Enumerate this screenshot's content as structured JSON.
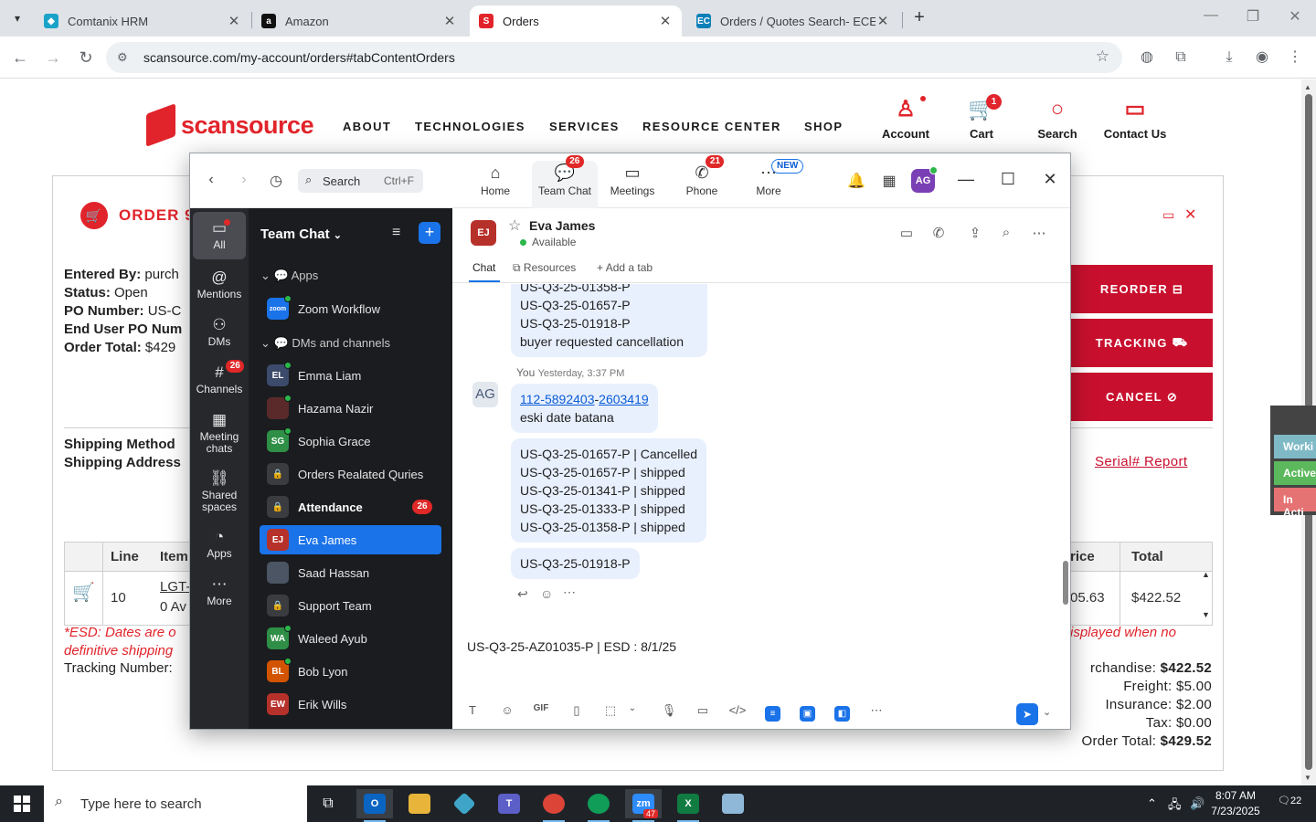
{
  "browser": {
    "tabs": [
      {
        "title": "Comtanix HRM",
        "active": false
      },
      {
        "title": "Amazon",
        "active": false
      },
      {
        "title": "Orders",
        "active": true
      },
      {
        "title": "Orders / Quotes Search- ECExp",
        "active": false
      }
    ],
    "url": "scansource.com/my-account/orders#tabContentOrders"
  },
  "site": {
    "logo_text": "scansource",
    "nav": [
      "ABOUT",
      "TECHNOLOGIES",
      "SERVICES",
      "RESOURCE CENTER",
      "SHOP"
    ],
    "util": [
      {
        "label": "Account",
        "icon": "user-icon"
      },
      {
        "label": "Cart",
        "icon": "cart-icon",
        "count": "1"
      },
      {
        "label": "Search",
        "icon": "search-icon"
      },
      {
        "label": "Contact Us",
        "icon": "chat-bubble-icon"
      }
    ],
    "order": {
      "title": "ORDER 9",
      "entered_by": "Entered By:",
      "entered_by_val": "purch",
      "status": "Status:",
      "status_val": "Open",
      "po": "PO Number:",
      "po_val": "US-C",
      "enduser_po": "End User PO Num",
      "order_total": "Order Total:",
      "order_total_val": "$429",
      "shipping_method": "Shipping Method",
      "shipping_address": "Shipping Address",
      "buttons": [
        "REORDER",
        "TRACKING",
        "CANCEL"
      ],
      "serial_report": "Serial# Report",
      "table": {
        "headers": [
          "Line",
          "Item",
          "rice",
          "Total"
        ],
        "row": {
          "line": "10",
          "item": "LGT-",
          "item_sub": "0 Av",
          "price": "05.63",
          "total": "$422.52"
        }
      },
      "esd_note_1": "*ESD: Dates are o",
      "esd_note_2": "definitive shipping",
      "esd_note_right": "isplayed when no",
      "tracking_number": "Tracking Number:",
      "totals": {
        "merch_label": "rchandise:",
        "merch": "$422.52",
        "freight_label": "Freight:",
        "freight": "$5.00",
        "insurance_label": "Insurance:",
        "insurance": "$2.00",
        "tax_label": "Tax:",
        "tax": "$0.00",
        "order_total_label": "Order Total:",
        "order_total": "$429.52"
      }
    },
    "side_tabs": [
      {
        "label": "Worki",
        "color": "#7fb9c6"
      },
      {
        "label": "Active",
        "color": "#5cb85c"
      },
      {
        "label": "In Acti",
        "color": "#e57373"
      }
    ]
  },
  "zoom": {
    "search_label": "Search",
    "search_kbd": "Ctrl+F",
    "tabs": [
      {
        "label": "Home",
        "icon": "home-icon"
      },
      {
        "label": "Team Chat",
        "icon": "chat-icon",
        "badge": "26"
      },
      {
        "label": "Meetings",
        "icon": "video-icon"
      },
      {
        "label": "Phone",
        "icon": "phone-icon",
        "badge": "21"
      },
      {
        "label": "More",
        "icon": "more-icon",
        "badge": "NEW"
      }
    ],
    "avatar": "AG",
    "rail": [
      {
        "label": "All",
        "icon": "chat-icon"
      },
      {
        "label": "Mentions",
        "icon": "at-icon"
      },
      {
        "label": "DMs",
        "icon": "people-icon"
      },
      {
        "label": "Channels",
        "icon": "hash-icon",
        "badge": "26"
      },
      {
        "label": "Meeting chats",
        "icon": "calendar-icon"
      },
      {
        "label": "Shared spaces",
        "icon": "share-icon"
      },
      {
        "label": "Apps",
        "icon": "apps-icon"
      },
      {
        "label": "More",
        "icon": "more-icon"
      }
    ],
    "sidebar": {
      "title": "Team Chat",
      "apps_section": "Apps",
      "dms_section": "DMs and channels",
      "items": [
        {
          "name": "Zoom Workflow",
          "initials": "zoom",
          "color": "#1a73e8"
        },
        {
          "name": "Emma Liam",
          "initials": "EL",
          "color": "#3c4a6b"
        },
        {
          "name": "Hazama Nazir",
          "initials": "",
          "color": "#5a2a2a"
        },
        {
          "name": "Sophia Grace",
          "initials": "SG",
          "color": "#2f8f46"
        },
        {
          "name": "Orders Realated Quries",
          "initials": "",
          "color": "#3a3c40"
        },
        {
          "name": "Attendance",
          "initials": "",
          "color": "#3a3c40",
          "count": "26"
        },
        {
          "name": "Eva James",
          "initials": "EJ",
          "color": "#b7312b"
        },
        {
          "name": "Saad Hassan",
          "initials": "",
          "color": "#4b5563"
        },
        {
          "name": "Support Team",
          "initials": "",
          "color": "#3a3c40"
        },
        {
          "name": "Waleed Ayub",
          "initials": "WA",
          "color": "#2f8f46"
        },
        {
          "name": "Bob Lyon",
          "initials": "BL",
          "color": "#d35400"
        },
        {
          "name": "Erik Wills",
          "initials": "EW",
          "color": "#b7312b"
        }
      ]
    },
    "chat": {
      "contact": "Eva James",
      "contact_initials": "EJ",
      "status": "Available",
      "tabs": [
        "Chat",
        "Resources",
        "Add a tab"
      ],
      "msg1_lines": [
        "US-Q3-25-01358-P",
        "US-Q3-25-01657-P",
        "US-Q3-25-01918-P",
        "buyer requested cancellation"
      ],
      "you_label": "You",
      "you_time": "Yesterday, 3:37 PM",
      "you_avatar": "AG",
      "link1": "112-5892403",
      "link_sep": "-",
      "link2": "2603419",
      "msg2_text": "eski date batana",
      "msg3_lines": [
        "US-Q3-25-01657-P | Cancelled",
        "US-Q3-25-01657-P | shipped",
        "US-Q3-25-01341-P | shipped",
        "US-Q3-25-01333-P | shipped",
        "US-Q3-25-01358-P | shipped"
      ],
      "msg4_text": "US-Q3-25-01918-P",
      "composer_text": "US-Q3-25-AZ01035-P | ESD : 8/1/25"
    }
  },
  "taskbar": {
    "search_placeholder": "Type here to search",
    "time": "8:07 AM",
    "date": "7/23/2025",
    "notif_count": "22",
    "zoom_badge": "47"
  }
}
